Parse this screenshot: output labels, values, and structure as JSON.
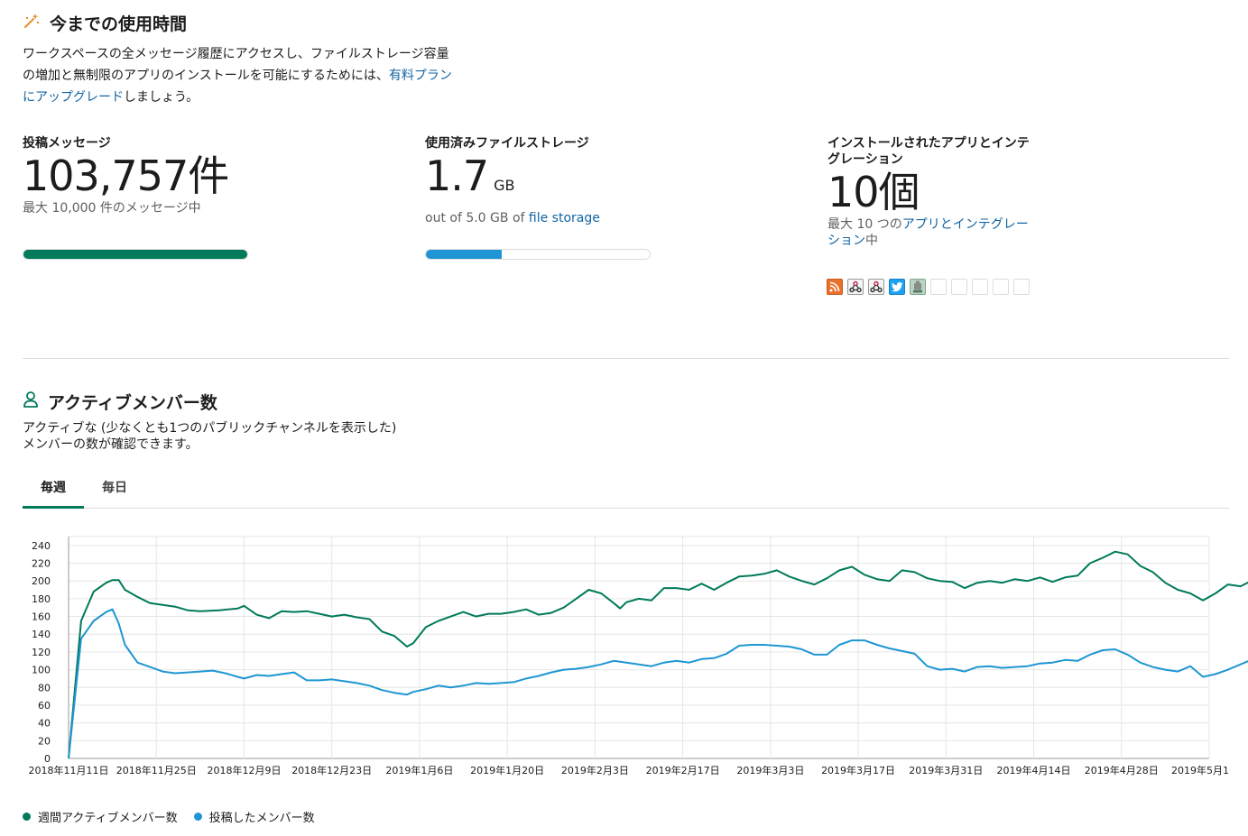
{
  "usage": {
    "title": "今までの使用時間",
    "desc_line1": "ワークスペースの全メッセージ履歴にアクセスし、ファイルストレージ容量",
    "desc_line2_a": "の増加と無制限のアプリのインストールを可能にするためには、",
    "desc_link_a": "有料プラン",
    "desc_link_b": "にアップグレード",
    "desc_line3_b": "しましょう。"
  },
  "stats": {
    "messages": {
      "label": "投稿メッセージ",
      "value": "103,757件",
      "sub": "最大 10,000 件のメッセージ中",
      "progress": 1.0,
      "color": "#007a5a"
    },
    "storage": {
      "label": "使用済みファイルストレージ",
      "value": "1.7",
      "unit": "GB",
      "sub_prefix": "out of 5.0 GB of ",
      "sub_link": "file storage",
      "progress": 0.34,
      "color": "#1f96d3"
    },
    "apps": {
      "label_line1": "インストールされたアプリとインテ",
      "label_line2": "グレーション",
      "value": "10個",
      "sub_prefix": "最大 10 つの",
      "sub_link_line1": "アプリとインテグレー",
      "sub_link_line2": "ション",
      "sub_suffix": "中",
      "icons": [
        "rss-icon",
        "webhook-icon",
        "webhook-icon",
        "twitter-icon",
        "bot-icon"
      ],
      "empty_slots": 5
    }
  },
  "active": {
    "title": "アクティブメンバー数",
    "desc_line1": "アクティブな (少なくとも1つのパブリックチャンネルを表示した)",
    "desc_line2": "メンバーの数が確認できます。",
    "tabs": [
      {
        "label": "毎週",
        "active": true
      },
      {
        "label": "毎日",
        "active": false
      }
    ]
  },
  "chart_data": {
    "type": "line",
    "ylim": [
      0,
      250
    ],
    "yticks": [
      0,
      20,
      40,
      60,
      80,
      100,
      120,
      140,
      160,
      180,
      200,
      220,
      240
    ],
    "x_tick_labels": [
      "2018年11月11日",
      "2018年11月25日",
      "2018年12月9日",
      "2018年12月23日",
      "2019年1月6日",
      "2019年1月20日",
      "2019年2月3日",
      "2019年2月17日",
      "2019年3月3日",
      "2019年3月17日",
      "2019年3月31日",
      "2019年4月14日",
      "2019年4月28日",
      "2019年5月1"
    ],
    "x_tick_days": [
      0,
      14,
      28,
      42,
      56,
      70,
      84,
      98,
      112,
      126,
      140,
      154,
      168,
      182
    ],
    "x_range_days": [
      0,
      182
    ],
    "grid": true,
    "series": [
      {
        "name": "週間アクティブメンバー数",
        "color": "#007a5a",
        "points": [
          [
            0,
            0
          ],
          [
            2,
            155
          ],
          [
            4,
            188
          ],
          [
            6,
            198
          ],
          [
            7,
            201
          ],
          [
            8,
            201
          ],
          [
            9,
            190
          ],
          [
            11,
            182
          ],
          [
            13,
            175
          ],
          [
            15,
            173
          ],
          [
            17,
            171
          ],
          [
            19,
            167
          ],
          [
            21,
            166
          ],
          [
            24,
            167
          ],
          [
            27,
            169
          ],
          [
            28,
            172
          ],
          [
            30,
            162
          ],
          [
            32,
            158
          ],
          [
            34,
            166
          ],
          [
            36,
            165
          ],
          [
            38,
            166
          ],
          [
            40,
            163
          ],
          [
            42,
            160
          ],
          [
            44,
            162
          ],
          [
            46,
            159
          ],
          [
            48,
            157
          ],
          [
            50,
            143
          ],
          [
            52,
            138
          ],
          [
            54,
            126
          ],
          [
            55,
            130
          ],
          [
            57,
            148
          ],
          [
            59,
            155
          ],
          [
            61,
            160
          ],
          [
            63,
            165
          ],
          [
            65,
            160
          ],
          [
            67,
            163
          ],
          [
            69,
            163
          ],
          [
            71,
            165
          ],
          [
            73,
            168
          ],
          [
            75,
            162
          ],
          [
            77,
            164
          ],
          [
            79,
            170
          ],
          [
            81,
            180
          ],
          [
            83,
            190
          ],
          [
            85,
            186
          ],
          [
            87,
            175
          ],
          [
            88,
            169
          ],
          [
            89,
            176
          ],
          [
            91,
            180
          ],
          [
            93,
            178
          ],
          [
            95,
            192
          ],
          [
            97,
            192
          ],
          [
            99,
            190
          ],
          [
            101,
            197
          ],
          [
            103,
            190
          ],
          [
            105,
            198
          ],
          [
            107,
            205
          ],
          [
            109,
            206
          ],
          [
            111,
            208
          ],
          [
            113,
            212
          ],
          [
            115,
            205
          ],
          [
            117,
            200
          ],
          [
            119,
            196
          ],
          [
            121,
            203
          ],
          [
            123,
            212
          ],
          [
            125,
            216
          ],
          [
            127,
            207
          ],
          [
            129,
            202
          ],
          [
            131,
            200
          ],
          [
            133,
            212
          ],
          [
            135,
            210
          ],
          [
            137,
            203
          ],
          [
            139,
            200
          ],
          [
            141,
            199
          ],
          [
            143,
            192
          ],
          [
            145,
            198
          ],
          [
            147,
            200
          ],
          [
            149,
            198
          ],
          [
            151,
            202
          ],
          [
            153,
            200
          ],
          [
            155,
            204
          ],
          [
            157,
            199
          ],
          [
            159,
            204
          ],
          [
            161,
            206
          ],
          [
            163,
            220
          ],
          [
            165,
            226
          ],
          [
            167,
            233
          ],
          [
            169,
            230
          ],
          [
            171,
            217
          ],
          [
            173,
            210
          ],
          [
            175,
            198
          ],
          [
            177,
            190
          ],
          [
            179,
            186
          ],
          [
            181,
            178
          ],
          [
            183,
            186
          ],
          [
            185,
            196
          ],
          [
            187,
            194
          ],
          [
            189,
            201
          ],
          [
            191,
            200
          ]
        ]
      },
      {
        "name": "投稿したメンバー数",
        "color": "#1f96d3",
        "points": [
          [
            0,
            0
          ],
          [
            2,
            135
          ],
          [
            4,
            155
          ],
          [
            6,
            165
          ],
          [
            7,
            168
          ],
          [
            8,
            152
          ],
          [
            9,
            128
          ],
          [
            11,
            108
          ],
          [
            13,
            103
          ],
          [
            15,
            98
          ],
          [
            17,
            96
          ],
          [
            19,
            97
          ],
          [
            21,
            98
          ],
          [
            23,
            99
          ],
          [
            25,
            96
          ],
          [
            27,
            92
          ],
          [
            28,
            90
          ],
          [
            30,
            94
          ],
          [
            32,
            93
          ],
          [
            34,
            95
          ],
          [
            36,
            97
          ],
          [
            38,
            88
          ],
          [
            40,
            88
          ],
          [
            42,
            89
          ],
          [
            44,
            87
          ],
          [
            46,
            85
          ],
          [
            48,
            82
          ],
          [
            50,
            77
          ],
          [
            52,
            74
          ],
          [
            54,
            72
          ],
          [
            55,
            75
          ],
          [
            57,
            78
          ],
          [
            59,
            82
          ],
          [
            61,
            80
          ],
          [
            63,
            82
          ],
          [
            65,
            85
          ],
          [
            67,
            84
          ],
          [
            69,
            85
          ],
          [
            71,
            86
          ],
          [
            73,
            90
          ],
          [
            75,
            93
          ],
          [
            77,
            97
          ],
          [
            79,
            100
          ],
          [
            81,
            101
          ],
          [
            83,
            103
          ],
          [
            85,
            106
          ],
          [
            87,
            110
          ],
          [
            89,
            108
          ],
          [
            91,
            106
          ],
          [
            93,
            104
          ],
          [
            95,
            108
          ],
          [
            97,
            110
          ],
          [
            99,
            108
          ],
          [
            101,
            112
          ],
          [
            103,
            113
          ],
          [
            105,
            118
          ],
          [
            107,
            127
          ],
          [
            109,
            128
          ],
          [
            111,
            128
          ],
          [
            113,
            127
          ],
          [
            115,
            126
          ],
          [
            117,
            123
          ],
          [
            119,
            117
          ],
          [
            121,
            117
          ],
          [
            123,
            128
          ],
          [
            125,
            133
          ],
          [
            127,
            133
          ],
          [
            129,
            128
          ],
          [
            131,
            124
          ],
          [
            133,
            121
          ],
          [
            135,
            118
          ],
          [
            137,
            104
          ],
          [
            139,
            100
          ],
          [
            141,
            101
          ],
          [
            143,
            98
          ],
          [
            145,
            103
          ],
          [
            147,
            104
          ],
          [
            149,
            102
          ],
          [
            151,
            103
          ],
          [
            153,
            104
          ],
          [
            155,
            107
          ],
          [
            157,
            108
          ],
          [
            159,
            111
          ],
          [
            161,
            110
          ],
          [
            163,
            117
          ],
          [
            165,
            122
          ],
          [
            167,
            123
          ],
          [
            169,
            117
          ],
          [
            171,
            108
          ],
          [
            173,
            103
          ],
          [
            175,
            100
          ],
          [
            177,
            98
          ],
          [
            179,
            104
          ],
          [
            181,
            92
          ],
          [
            183,
            95
          ],
          [
            185,
            100
          ],
          [
            187,
            106
          ],
          [
            189,
            112
          ],
          [
            191,
            111
          ]
        ]
      }
    ]
  }
}
